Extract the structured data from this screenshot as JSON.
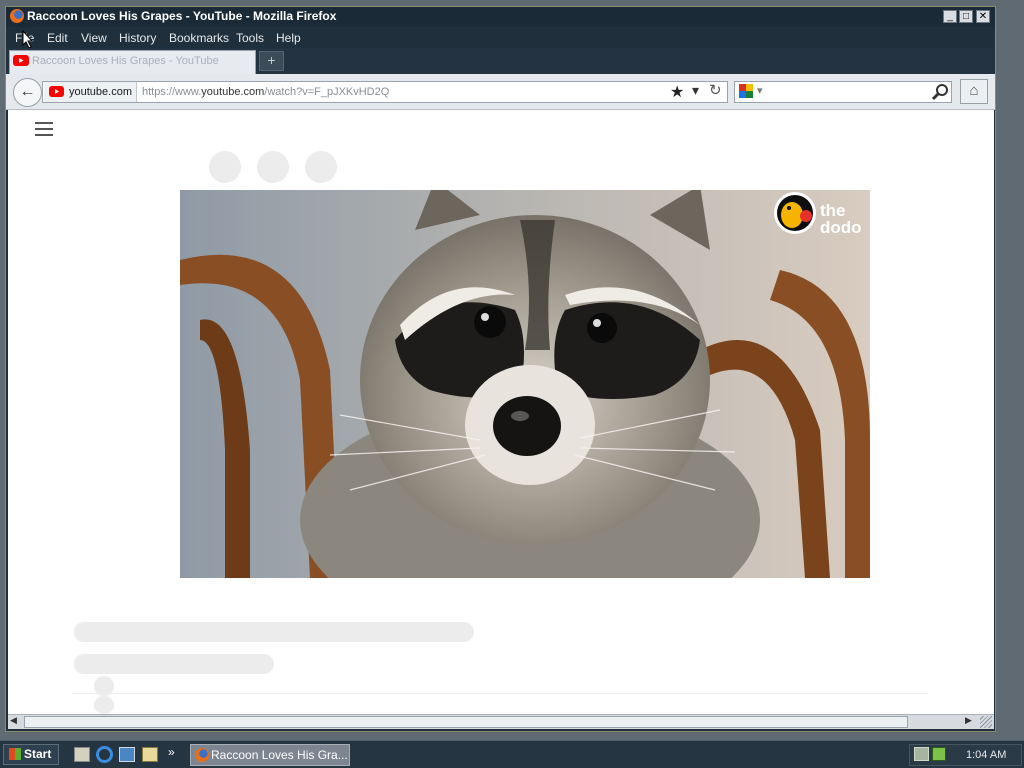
{
  "window": {
    "title": "Raccoon Loves His Grapes - YouTube - Mozilla Firefox",
    "controls": {
      "minimize": "_",
      "maximize": "□",
      "close": "✕"
    }
  },
  "menubar": {
    "items": [
      {
        "label": "File"
      },
      {
        "label": "Edit"
      },
      {
        "label": "View"
      },
      {
        "label": "History"
      },
      {
        "label": "Bookmarks"
      },
      {
        "label": "Tools"
      },
      {
        "label": "Help"
      }
    ]
  },
  "tab": {
    "title": "Raccoon Loves His Grapes - YouTube",
    "new_tab_icon": "+"
  },
  "navbar": {
    "back_icon": "←",
    "site_identity": "youtube.com",
    "url_prefix": "https://www.",
    "url_domain": "youtube.com",
    "url_path": "/watch?v=F_pJXKvHD2Q",
    "star_icon": "★",
    "dropdown_icon": "▾",
    "reload_icon": "↻",
    "search_dropdown_icon": "▾",
    "search_icon": "⚲",
    "home_icon": "⌂"
  },
  "content": {
    "video_watermark": "the dodo"
  },
  "scrollbar": {
    "left_icon": "◀",
    "right_icon": "▶"
  },
  "taskbar": {
    "start_label": "Start",
    "task_label": "Raccoon Loves His Gra...",
    "more_icon": "»",
    "clock": "1:04 AM"
  },
  "colors": {
    "titlebar": "#1a2a36",
    "taskbar": "#263542",
    "youtube_red": "#ff0000",
    "page_bg": "#ffffff",
    "skeleton": "#ececec"
  }
}
